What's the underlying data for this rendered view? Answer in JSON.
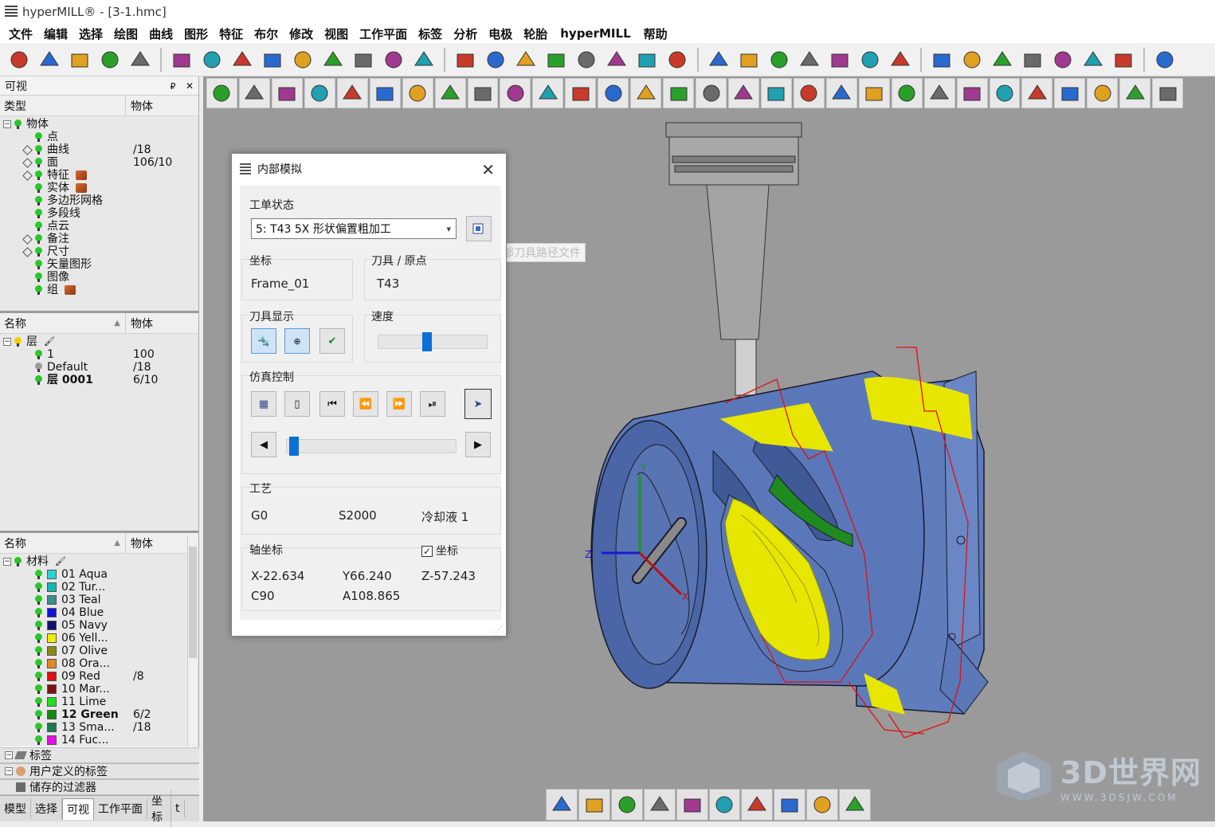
{
  "window": {
    "title": "hyperMILL® - [3-1.hmc]"
  },
  "menu": [
    "文件",
    "编辑",
    "选择",
    "绘图",
    "曲线",
    "图形",
    "特征",
    "布尔",
    "修改",
    "视图",
    "工作平面",
    "标签",
    "分析",
    "电极",
    "轮胎",
    "hyperMILL",
    "帮助"
  ],
  "toolbar1_icons": [
    "sketch-icon",
    "line-icon",
    "rectangle-icon",
    "point-grid-icon",
    "circle-icon",
    "surface-icon",
    "plane-icon",
    "extrude-icon",
    "revolve-icon",
    "sweep-icon",
    "loft-icon",
    "patch-icon",
    "blend-icon",
    "skin-icon",
    "box-icon",
    "cylinder-icon",
    "boolean-icon",
    "trim-icon",
    "offset-icon",
    "fillet-icon",
    "chamfer-icon",
    "shell-icon",
    "arc-icon",
    "spline-icon",
    "curve-icon",
    "edge-icon",
    "sphere-icon",
    "helix-icon",
    "tube-icon",
    "dimension-icon",
    "angle-icon",
    "radius-icon",
    "annotation-icon",
    "measure-icon",
    "draft-icon",
    "section-icon",
    "toolbar-menu-icon"
  ],
  "toolbar2_icons": [
    "new-icon",
    "open-icon",
    "save-icon",
    "delete-icon",
    "info-icon",
    "info2-icon",
    "undo-icon",
    "redo-icon",
    "reset-icon",
    "shaded-icon",
    "view-front-icon",
    "view-top-icon",
    "view-right-icon",
    "view-iso-icon",
    "view-back-icon",
    "wireframe-icon",
    "hidden-icon",
    "edges-icon",
    "solid-icon",
    "color-icon",
    "material-icon",
    "highlight-icon",
    "crop-icon",
    "cut-icon",
    "measure-icon",
    "fill-icon",
    "layer-icon",
    "green-face-icon",
    "plus-icon",
    "globe-icon"
  ],
  "panel_visibility": {
    "title": "可视",
    "pin": "₽",
    "close": "✕",
    "col_type": "类型",
    "col_object": "物体",
    "root": "物体",
    "items": [
      {
        "label": "点",
        "value": "",
        "expand": false
      },
      {
        "label": "曲线",
        "value": "/18",
        "expand": true
      },
      {
        "label": "面",
        "value": "106/10",
        "expand": true
      },
      {
        "label": "特征",
        "value": "",
        "expand": true,
        "cube": true
      },
      {
        "label": "实体",
        "value": "",
        "expand": false,
        "cube": true
      },
      {
        "label": "多边形网格",
        "value": "",
        "expand": false
      },
      {
        "label": "多段线",
        "value": "",
        "expand": false
      },
      {
        "label": "点云",
        "value": "",
        "expand": false
      },
      {
        "label": "备注",
        "value": "",
        "expand": true
      },
      {
        "label": "尺寸",
        "value": "",
        "expand": true
      },
      {
        "label": "矢量图形",
        "value": "",
        "expand": false
      },
      {
        "label": "图像",
        "value": "",
        "expand": false
      },
      {
        "label": "组",
        "value": "",
        "expand": false,
        "cube": true
      }
    ]
  },
  "panel_layers": {
    "col_name": "名称",
    "col_object": "物体",
    "root": "层",
    "items": [
      {
        "label": "1",
        "value": "100",
        "bulb": "green",
        "bold": false
      },
      {
        "label": "Default",
        "value": "/18",
        "bulb": "gray",
        "bold": false
      },
      {
        "label": "层  0001",
        "value": "6/10",
        "bulb": "green",
        "bold": true
      }
    ]
  },
  "panel_materials": {
    "col_name": "名称",
    "col_object": "物体",
    "root": "材料",
    "items": [
      {
        "label": "01 Aqua",
        "value": "",
        "color": "#2ad4d4",
        "bold": false
      },
      {
        "label": "02 Tur...",
        "value": "",
        "color": "#12b6b6",
        "bold": false
      },
      {
        "label": "03 Teal",
        "value": "",
        "color": "#3a8f8f",
        "bold": false
      },
      {
        "label": "04 Blue",
        "value": "",
        "color": "#1010e0",
        "bold": false
      },
      {
        "label": "05 Navy",
        "value": "",
        "color": "#101070",
        "bold": false
      },
      {
        "label": "06 Yell...",
        "value": "",
        "color": "#f0f000",
        "bold": false
      },
      {
        "label": "07 Olive",
        "value": "",
        "color": "#8a8a10",
        "bold": false
      },
      {
        "label": "08 Ora...",
        "value": "",
        "color": "#e08a20",
        "bold": false
      },
      {
        "label": "09 Red",
        "value": "/8",
        "color": "#e01010",
        "bold": false
      },
      {
        "label": "10 Mar...",
        "value": "",
        "color": "#801010",
        "bold": false
      },
      {
        "label": "11 Lime",
        "value": "",
        "color": "#20e020",
        "bold": false
      },
      {
        "label": "12 Green",
        "value": "6/2",
        "color": "#108a10",
        "bold": true
      },
      {
        "label": "13 Sma...",
        "value": "/18",
        "color": "#1a7a4a",
        "bold": false
      },
      {
        "label": "14 Fuc...",
        "value": "",
        "color": "#e010e0",
        "bold": false
      }
    ]
  },
  "section_tags": "标签",
  "section_user_tags": "用户定义的标签",
  "section_filters": "储存的过滤器",
  "bottom_tabs": [
    "模型",
    "选择",
    "可视",
    "工作平面",
    "坐标",
    "t"
  ],
  "sim_dialog": {
    "title": "内部模拟",
    "close": "✕",
    "job_status_label": "工单状态",
    "job_selected": "5: T43 5X 形状偏置粗加工",
    "tooltip": "加载外部刀具路径文件",
    "coord_label": "坐标",
    "coord_value": "Frame_01",
    "tool_label": "刀具 / 原点",
    "tool_value": "T43",
    "tool_display_label": "刀具显示",
    "speed_label": "速度",
    "speed": 0.45,
    "sim_control_label": "仿真控制",
    "progress": 0.02,
    "process_label": "工艺",
    "process_g": "G0",
    "process_s": "S2000",
    "process_coolant": "冷却液  1",
    "axis_label": "轴坐标",
    "axis_check_label": "坐标",
    "x": "X-22.634",
    "y": "Y66.240",
    "z": "Z-57.243",
    "c": "C90",
    "a": "A108.865"
  },
  "viewport": {
    "axis_x": "X",
    "axis_y": "Y",
    "axis_z": "Z"
  },
  "viewbar_icons": [
    "layers-view-icon",
    "globe-view-icon",
    "plane-view-icon",
    "paint-icon",
    "pin-icon",
    "dimension-view-icon",
    "point-icon",
    "color-map-icon",
    "pencil-icon",
    "mesh-view-icon"
  ],
  "watermark": {
    "text": "3D世界网",
    "url": "WWW.3DSJW.COM"
  },
  "colors": {
    "part": "#5b78b8",
    "toolpath": "#f2f000",
    "path_red": "#e01010",
    "viewport_bg": "#9a9a9a"
  }
}
